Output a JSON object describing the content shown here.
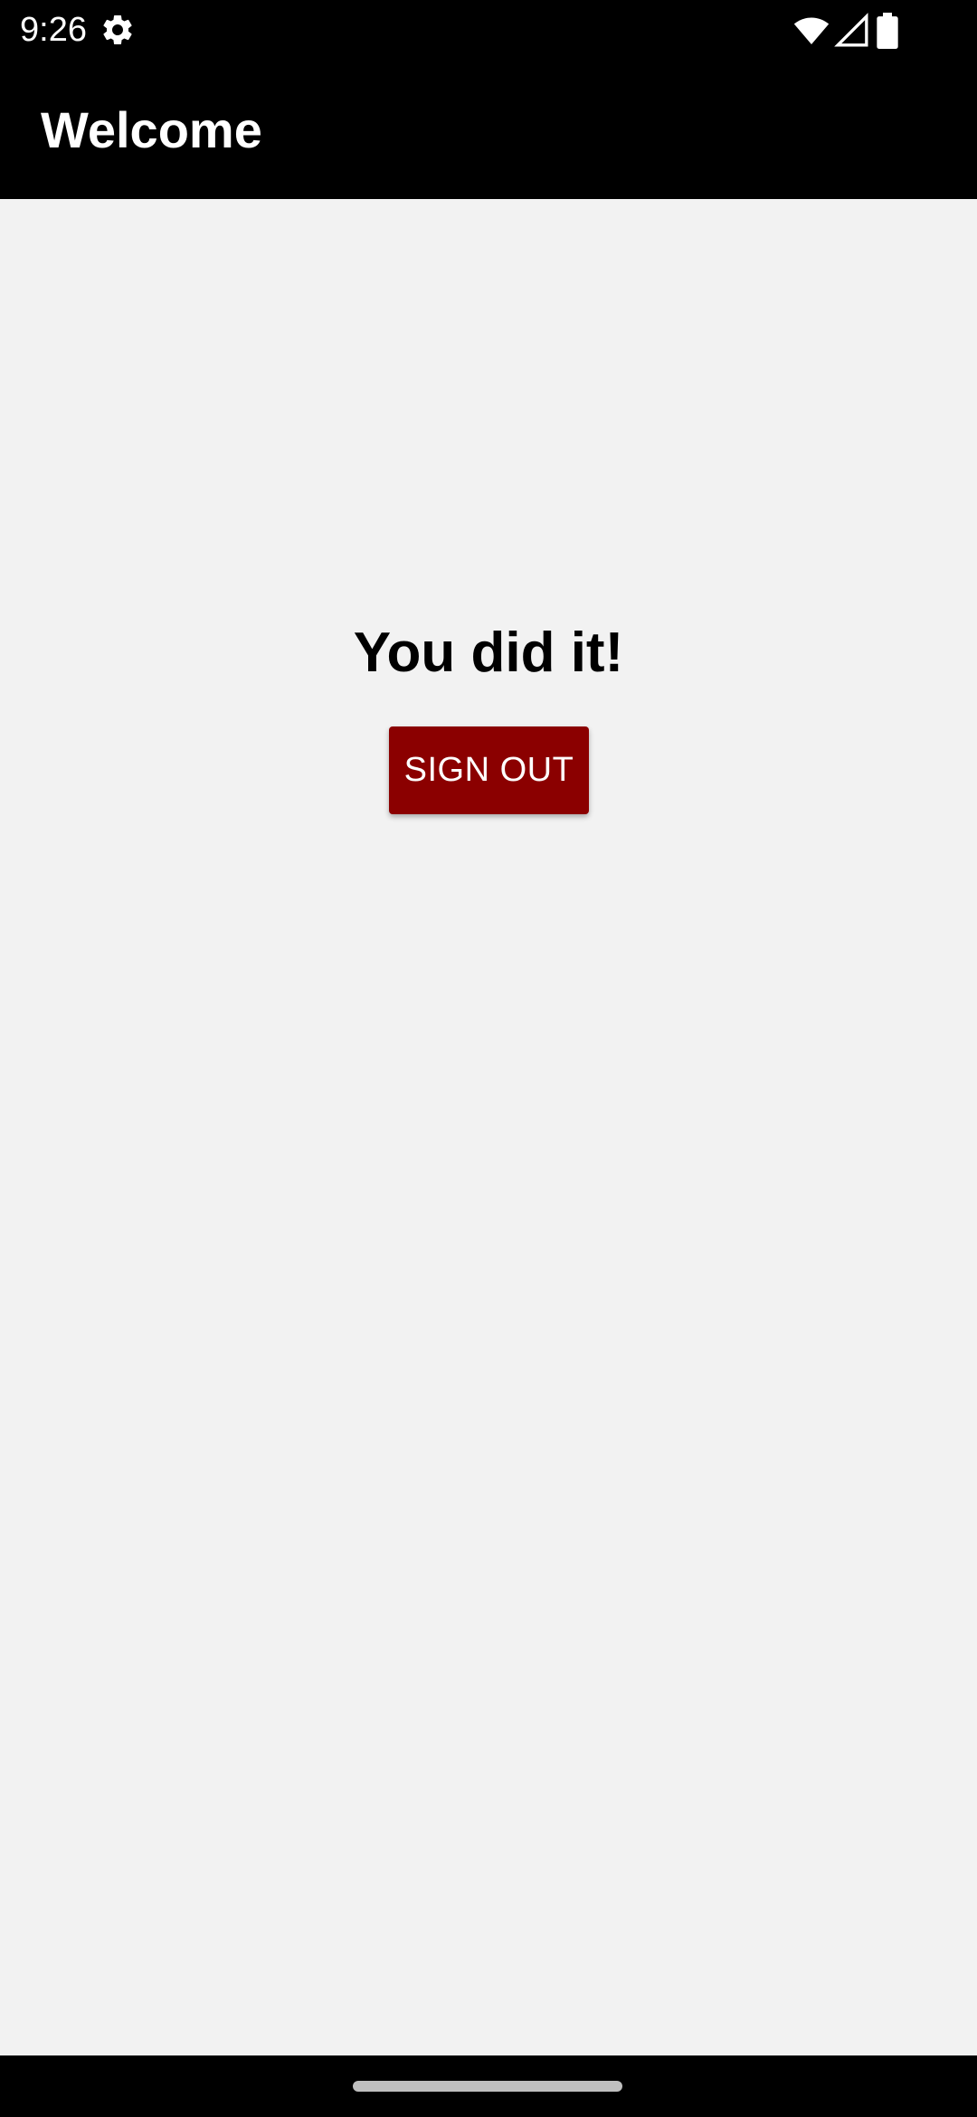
{
  "status_bar": {
    "time": "9:26",
    "icons": [
      "settings-icon",
      "wifi-icon",
      "signal-icon",
      "battery-icon"
    ]
  },
  "app_bar": {
    "title": "Welcome",
    "background_color": "#000000"
  },
  "main": {
    "headline": "You did it!",
    "sign_out_label": "SIGN OUT",
    "button_color": "#8b0000",
    "background_color": "#f2f2f2"
  },
  "nav_bar": {
    "handle": "home-gesture-handle"
  }
}
